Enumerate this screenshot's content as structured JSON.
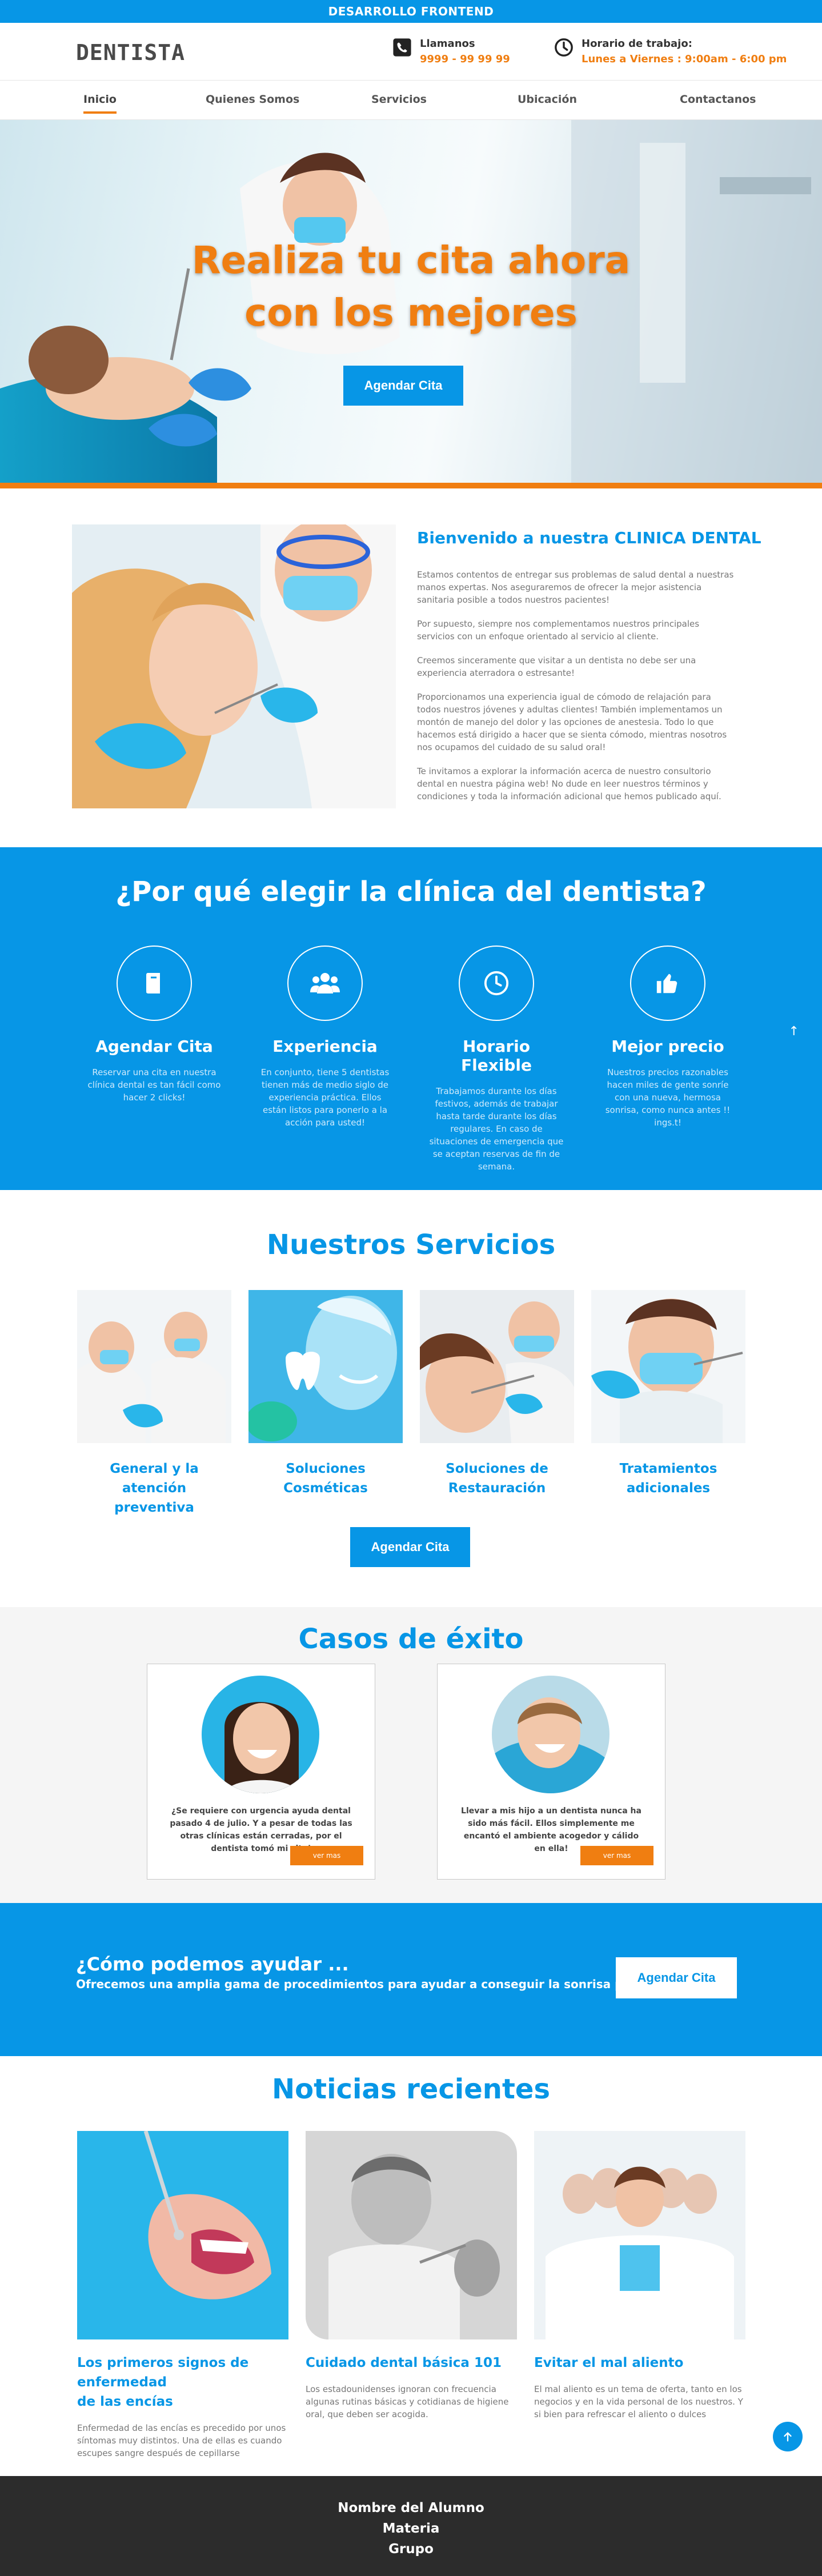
{
  "topbar": {
    "title": "DESARROLLO FRONTEND"
  },
  "header": {
    "brand": "DENTISTA",
    "phone": {
      "label": "Llamanos",
      "value": "9999 - 99 99 99",
      "icon": "phone-icon"
    },
    "hours": {
      "label": "Horario de trabajo:",
      "value": "Lunes a Viernes : 9:00am - 6:00 pm",
      "icon": "clock-icon"
    }
  },
  "nav": {
    "items": [
      {
        "label": "Inicio",
        "active": true
      },
      {
        "label": "Quienes Somos"
      },
      {
        "label": "Servicios"
      },
      {
        "label": "Ubicación"
      },
      {
        "label": "Contactanos"
      }
    ]
  },
  "hero": {
    "line1": "Realiza tu cita ahora",
    "line2": "con los mejores",
    "button": "Agendar Cita"
  },
  "welcome": {
    "title": "Bienvenido a nuestra CLINICA DENTAL",
    "paragraphs": [
      "Estamos contentos de entregar sus problemas de salud dental a nuestras manos expertas. Nos aseguraremos de ofrecer la mejor asistencia sanitaria posible a todos nuestros pacientes!",
      "Por supuesto, siempre nos complementamos nuestros principales servicios con un enfoque orientado al servicio al cliente.",
      "Creemos sinceramente que visitar a un dentista no debe ser una experiencia aterradora o estresante!",
      "Proporcionamos una experiencia igual de cómodo de relajación para todos nuestros jóvenes y adultas clientes! También implementamos un montón de manejo del dolor y las opciones de anestesia. Todo lo que hacemos está dirigido a hacer que se sienta cómodo, mientras nosotros nos ocupamos del cuidado de su salud oral!",
      "Te invitamos a explorar la información acerca de nuestro consultorio dental en nuestra página web! No dude en leer nuestros términos y condiciones y toda la información adicional que hemos publicado aquí."
    ]
  },
  "why": {
    "title": "¿Por qué elegir la clínica del dentista?",
    "features": [
      {
        "title": "Agendar Cita",
        "text": "Reservar una cita en nuestra clínica dental es tan fácil como hacer 2 clicks!",
        "icon": "book-icon"
      },
      {
        "title": "Experiencia",
        "text": "En conjunto, tiene 5 dentistas tienen más de medio siglo de experiencia práctica. Ellos están listos para ponerlo a la acción para usted!",
        "icon": "group-icon"
      },
      {
        "title": "Horario Flexible",
        "text": "Trabajamos durante los días festivos, además de trabajar hasta tarde durante los días regulares. En caso de situaciones de emergencia que se aceptan reservas de fin de semana.",
        "icon": "clock-icon"
      },
      {
        "title": "Mejor precio",
        "text": "Nuestros precios razonables hacen miles de gente sonríe con una nueva, hermosa sonrisa, como nunca antes !! ings.t!",
        "icon": "thumbs-up-icon"
      }
    ]
  },
  "services": {
    "title": "Nuestros Servicios",
    "items": [
      {
        "line1": "General y la atención",
        "line2": "preventiva"
      },
      {
        "line1": "Soluciones",
        "line2": "Cosméticas"
      },
      {
        "line1": "Soluciones de",
        "line2": "Restauración"
      },
      {
        "line1": "Tratamientos",
        "line2": "adicionales"
      }
    ],
    "button": "Agendar Cita"
  },
  "cases": {
    "title": "Casos de éxito",
    "cards": [
      {
        "text": "¿Se requiere con urgencia ayuda dental pasado 4 de julio. Y a pesar de todas las otras clínicas están cerradas, por el dentista tomó mi cita!",
        "button": "ver mas"
      },
      {
        "text": "Llevar a mis hijo a un dentista nunca ha sido más fácil. Ellos simplemente me encantó el ambiente acogedor y cálido en ella!",
        "button": "ver mas"
      }
    ]
  },
  "cta": {
    "title": "¿Cómo podemos ayudar ...",
    "text": "Ofrecemos una amplia gama de procedimientos para ayudar a conseguir la sonrisa perfecta.",
    "button": "Agendar Cita"
  },
  "news": {
    "title": "Noticias recientes",
    "posts": [
      {
        "line1": "Los primeros signos de enfermedad",
        "line2": "de las encías",
        "text": "Enfermedad de las encías es precedido por unos síntomas muy distintos. Una de ellas es cuando escupes sangre después de cepillarse"
      },
      {
        "line1": "Cuidado dental básica 101",
        "line2": "",
        "text": "Los estadounidenses ignoran con frecuencia algunas rutinas básicas y cotidianas de higiene oral, que deben ser acogida."
      },
      {
        "line1": "Evitar el mal aliento",
        "line2": "",
        "text": "El mal aliento es un tema de oferta, tanto en los negocios y en la vida personal de los nuestros. Y si bien para refrescar el aliento o dulces"
      }
    ]
  },
  "footer": {
    "line1": "Nombre del Alumno",
    "line2": "Materia",
    "line3": "Grupo"
  },
  "colors": {
    "primary": "#0796e6",
    "accent": "#f07e11",
    "footer": "#2c2c2c"
  }
}
